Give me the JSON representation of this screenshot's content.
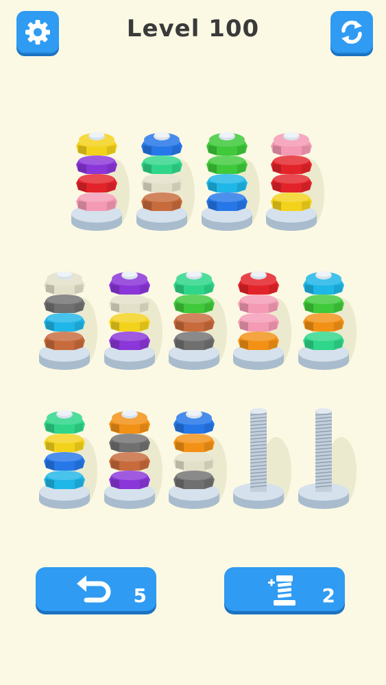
{
  "header": {
    "level_title": "Level 100"
  },
  "colors": {
    "yellow": "#f3d21c",
    "purple": "#8a36d8",
    "red": "#e3232a",
    "pink": "#f49ab4",
    "blue": "#2677e8",
    "mint": "#2fd68a",
    "cream": "#e3e0c9",
    "brown": "#c76a3c",
    "green": "#3fc93b",
    "cyan": "#1fb6e8",
    "gray": "#707070",
    "orange": "#f29116",
    "button_blue": "#2f9bf2",
    "background": "#fbf9e4"
  },
  "rows": [
    {
      "poles": [
        {
          "nuts": [
            "pink",
            "red",
            "purple",
            "yellow"
          ]
        },
        {
          "nuts": [
            "brown",
            "cream",
            "mint",
            "blue"
          ]
        },
        {
          "nuts": [
            "blue",
            "cyan",
            "green",
            "green"
          ]
        },
        {
          "nuts": [
            "yellow",
            "red",
            "red",
            "pink"
          ]
        }
      ]
    },
    {
      "poles": [
        {
          "nuts": [
            "brown",
            "cyan",
            "gray",
            "cream"
          ]
        },
        {
          "nuts": [
            "purple",
            "yellow",
            "cream",
            "purple"
          ]
        },
        {
          "nuts": [
            "gray",
            "brown",
            "green",
            "mint"
          ]
        },
        {
          "nuts": [
            "orange",
            "pink",
            "pink",
            "red"
          ]
        },
        {
          "nuts": [
            "mint",
            "orange",
            "green",
            "cyan"
          ]
        }
      ]
    },
    {
      "poles": [
        {
          "nuts": [
            "cyan",
            "blue",
            "yellow",
            "mint"
          ]
        },
        {
          "nuts": [
            "purple",
            "brown",
            "gray",
            "orange"
          ]
        },
        {
          "nuts": [
            "gray",
            "cream",
            "orange",
            "blue"
          ]
        },
        {
          "nuts": []
        },
        {
          "nuts": []
        }
      ]
    }
  ],
  "controls": {
    "undo_icon": "undo-arrow-icon",
    "undo_count": "5",
    "add_pole_icon": "add-bolt-icon",
    "add_pole_count": "2"
  },
  "top_icons": {
    "settings": "gear-icon",
    "restart": "refresh-icon"
  }
}
